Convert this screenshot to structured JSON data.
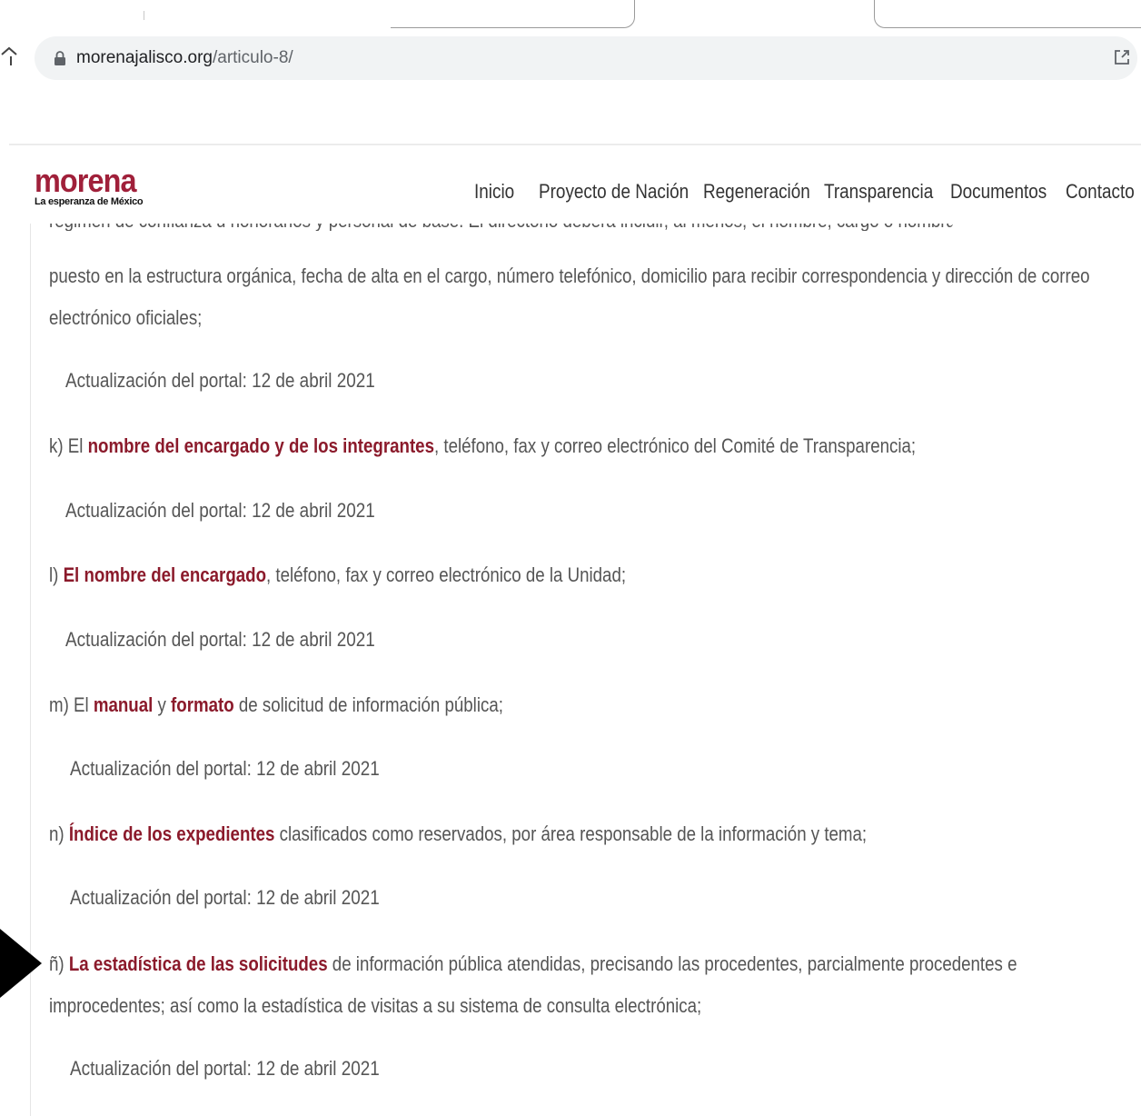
{
  "browser": {
    "url_domain": "morenajalisco.org",
    "url_path": "/articulo-8/"
  },
  "site": {
    "logo_text": "morena",
    "logo_tagline": "La esperanza de México",
    "nav": [
      "Inicio",
      "Proyecto de Nación",
      "Regeneración",
      "Transparencia",
      "Documentos",
      "Contacto"
    ]
  },
  "content": {
    "cut_top_line": "régimen de confianza u honorarios y personal de base. El directorio deberá incluir, al menos, el nombre, cargo o nombramiento asignado, nivel del",
    "j_rest": "puesto en la estructura orgánica, fecha de alta en el cargo, número telefónico, domicilio para recibir correspondencia y dirección de correo electrónico oficiales;",
    "update_text": "Actualización del portal: 12 de abril 2021",
    "k": {
      "prefix": "k) El ",
      "link": "nombre del encargado y de los integrantes",
      "suffix": ", teléfono, fax y correo electrónico del Comité de Transparencia;"
    },
    "l": {
      "prefix": "l) ",
      "link": "El nombre del encargado",
      "suffix": ", teléfono, fax y correo electrónico de la Unidad;"
    },
    "m": {
      "prefix": "m) El ",
      "link1": "manual",
      "mid": " y ",
      "link2": "formato",
      "suffix": " de solicitud de información pública;"
    },
    "n": {
      "prefix": "n) ",
      "link": "Índice de los expedientes",
      "suffix": " clasificados como reservados, por área responsable de la información y tema;"
    },
    "nn": {
      "prefix": "ñ) ",
      "link": "La estadística de las solicitudes",
      "suffix": " de información pública atendidas, precisando las procedentes, parcialmente procedentes e improcedentes; así como la estadística de visitas a su sistema de consulta electrónica;"
    }
  },
  "colors": {
    "brand": "#a0203a",
    "link": "#8b1a2b",
    "text": "#555555"
  }
}
